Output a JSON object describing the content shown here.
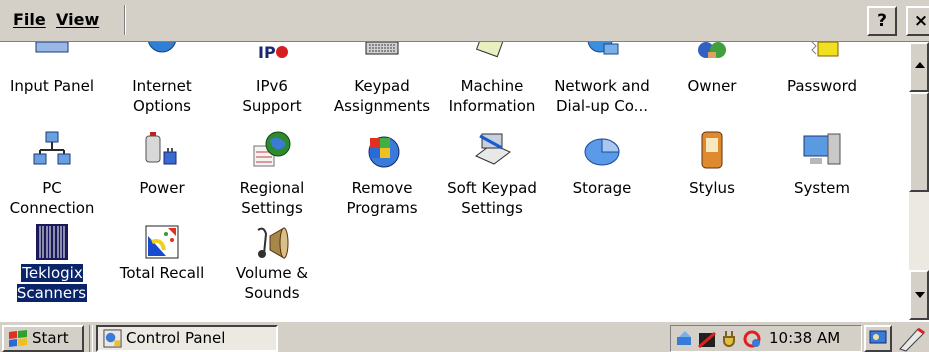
{
  "menu": {
    "file_label": "File",
    "view_label": "View",
    "help_label": "?",
    "close_label": "×"
  },
  "items": [
    {
      "label": "Input Panel",
      "icon": "input-panel-icon"
    },
    {
      "label": "Internet\nOptions",
      "icon": "internet-options-icon"
    },
    {
      "label": "IPv6\nSupport",
      "icon": "ipv6-support-icon"
    },
    {
      "label": "Keypad\nAssignments",
      "icon": "keypad-icon"
    },
    {
      "label": "Machine\nInformation",
      "icon": "machine-information-icon"
    },
    {
      "label": "Network and\nDial-up Co...",
      "icon": "network-icon"
    },
    {
      "label": "Owner",
      "icon": "owner-icon"
    },
    {
      "label": "Password",
      "icon": "password-icon"
    },
    {
      "label": "PC\nConnection",
      "icon": "pc-connection-icon"
    },
    {
      "label": "Power",
      "icon": "power-icon"
    },
    {
      "label": "Regional\nSettings",
      "icon": "regional-settings-icon"
    },
    {
      "label": "Remove\nPrograms",
      "icon": "remove-programs-icon"
    },
    {
      "label": "Soft Keypad\nSettings",
      "icon": "soft-keypad-icon"
    },
    {
      "label": "Storage",
      "icon": "storage-icon"
    },
    {
      "label": "Stylus",
      "icon": "stylus-icon"
    },
    {
      "label": "System",
      "icon": "system-icon"
    },
    {
      "label": "Teklogix\nScanners",
      "icon": "scanner-barcode-icon",
      "selected": true
    },
    {
      "label": "Total Recall",
      "icon": "total-recall-icon"
    },
    {
      "label": "Volume &\nSounds",
      "icon": "volume-sounds-icon"
    }
  ],
  "taskbar": {
    "start_label": "Start",
    "window_label": "Control Panel",
    "clock": "10:38 AM"
  },
  "colors": {
    "chrome": "#d4d0c8",
    "selection": "#0a246a"
  }
}
